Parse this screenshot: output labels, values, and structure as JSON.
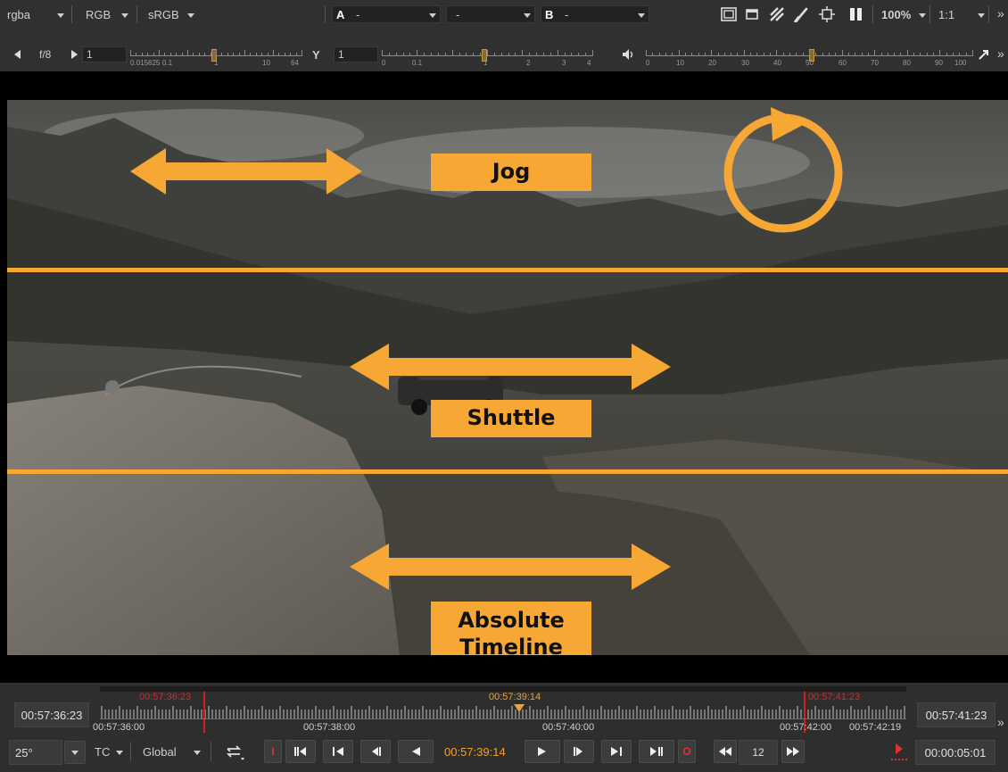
{
  "toolbar_top": {
    "channels": "rgba",
    "color_mode": "RGB",
    "colorspace": "sRGB",
    "input_a_label": "A",
    "input_a_value": "-",
    "blend_value": "-",
    "input_b_label": "B",
    "input_b_value": "-",
    "zoom": "100%",
    "ratio": "1:1"
  },
  "toolbar_second": {
    "fstop": "f/8",
    "gain_value": "1",
    "gain_ticks": [
      "0.015625",
      "0.1",
      "1",
      "10",
      "64"
    ],
    "gamma_label": "Y",
    "gamma_value": "1",
    "gamma_ticks": [
      "0",
      "0.1",
      "1",
      "2",
      "3",
      "4"
    ],
    "volume_ticks": [
      "0",
      "10",
      "20",
      "30",
      "40",
      "50",
      "60",
      "70",
      "80",
      "90",
      "100"
    ]
  },
  "annotations": {
    "jog": "Jog",
    "shuttle": "Shuttle",
    "absolute_timeline_line1": "Absolute",
    "absolute_timeline_line2": "Timeline",
    "color": "#f7a734"
  },
  "timeline": {
    "current_start": "00:57:36:23",
    "current_end": "00:57:41:23",
    "in_marker": "00:57:36:23",
    "playhead": "00:57:39:14",
    "out_marker": "00:57:41:23",
    "ruler_labels": [
      "00:57:36:00",
      "00:57:38:00",
      "00:57:40:00",
      "00:57:42:00",
      "00:57:42:19"
    ]
  },
  "transport": {
    "fps": "25°",
    "time_mode": "TC",
    "scope": "Global",
    "current_time": "00:57:39:14",
    "step_value": "12",
    "duration": "00:00:05:01",
    "in_label": "I",
    "out_label": "O"
  },
  "colors": {
    "marker_red": "#e02020",
    "playhead_orange": "#f0a030",
    "accent": "#f7a734"
  }
}
